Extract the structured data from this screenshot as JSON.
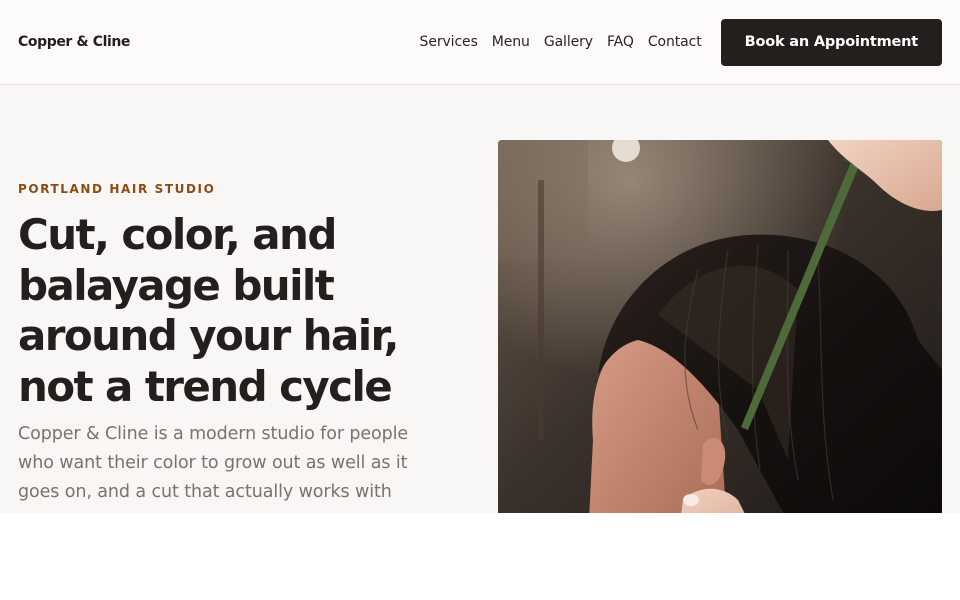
{
  "brand": {
    "name": "Copper & Cline"
  },
  "nav": {
    "links": [
      "Services",
      "Menu",
      "Gallery",
      "FAQ",
      "Contact"
    ],
    "cta_label": "Book an Appointment"
  },
  "hero": {
    "eyebrow": "PORTLAND HAIR STUDIO",
    "headline": [
      "Cut, color, and",
      "balayage built",
      "around your hair,",
      "not a trend cycle"
    ],
    "lede": [
      "Copper & Cline is a modern studio for people",
      "who want their color to grow out as well as it",
      "goes on, and a cut that actually works with"
    ]
  },
  "colors": {
    "accent": "#8a4b15",
    "ink": "#241f1c",
    "muted": "#7c716b",
    "page_bg": "#f9f7f5",
    "header_bg": "#fcfbf9"
  },
  "icons": {
    "hero_photo": "salon-photo"
  }
}
